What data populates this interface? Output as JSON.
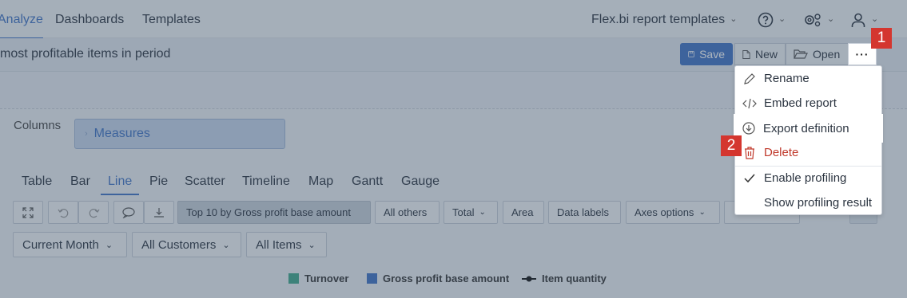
{
  "nav": {
    "tabs": [
      "Analyze",
      "Dashboards",
      "Templates"
    ],
    "templates_menu": "Flex.bi report templates"
  },
  "report": {
    "title": "most profitable items in period",
    "save": "Save",
    "new": "New",
    "open": "Open",
    "more": "···"
  },
  "layout": {
    "columns_label": "Columns",
    "columns_value": "Measures"
  },
  "chart_types": [
    "Table",
    "Bar",
    "Line",
    "Pie",
    "Scatter",
    "Timeline",
    "Map",
    "Gantt",
    "Gauge"
  ],
  "toolbar": {
    "top10": "Top 10 by Gross profit base amount",
    "all_others": "All others",
    "total": "Total",
    "area": "Area",
    "data_labels": "Data labels",
    "axes_options": "Axes options"
  },
  "filters": [
    "Current Month",
    "All Customers",
    "All Items"
  ],
  "legend": [
    "Turnover",
    "Gross profit base amount",
    "Item quantity"
  ],
  "menu": {
    "rename": "Rename",
    "embed": "Embed report",
    "export": "Export definition",
    "delete": "Delete",
    "profiling": "Enable profiling",
    "profiling_result": "Show profiling result"
  },
  "badges": [
    "1",
    "2"
  ],
  "colors": {
    "accent": "#3f73c4",
    "turnover": "#3fa88a",
    "gross_profit": "#3f73c4",
    "danger": "#c0392b",
    "badge": "#d4362f"
  }
}
